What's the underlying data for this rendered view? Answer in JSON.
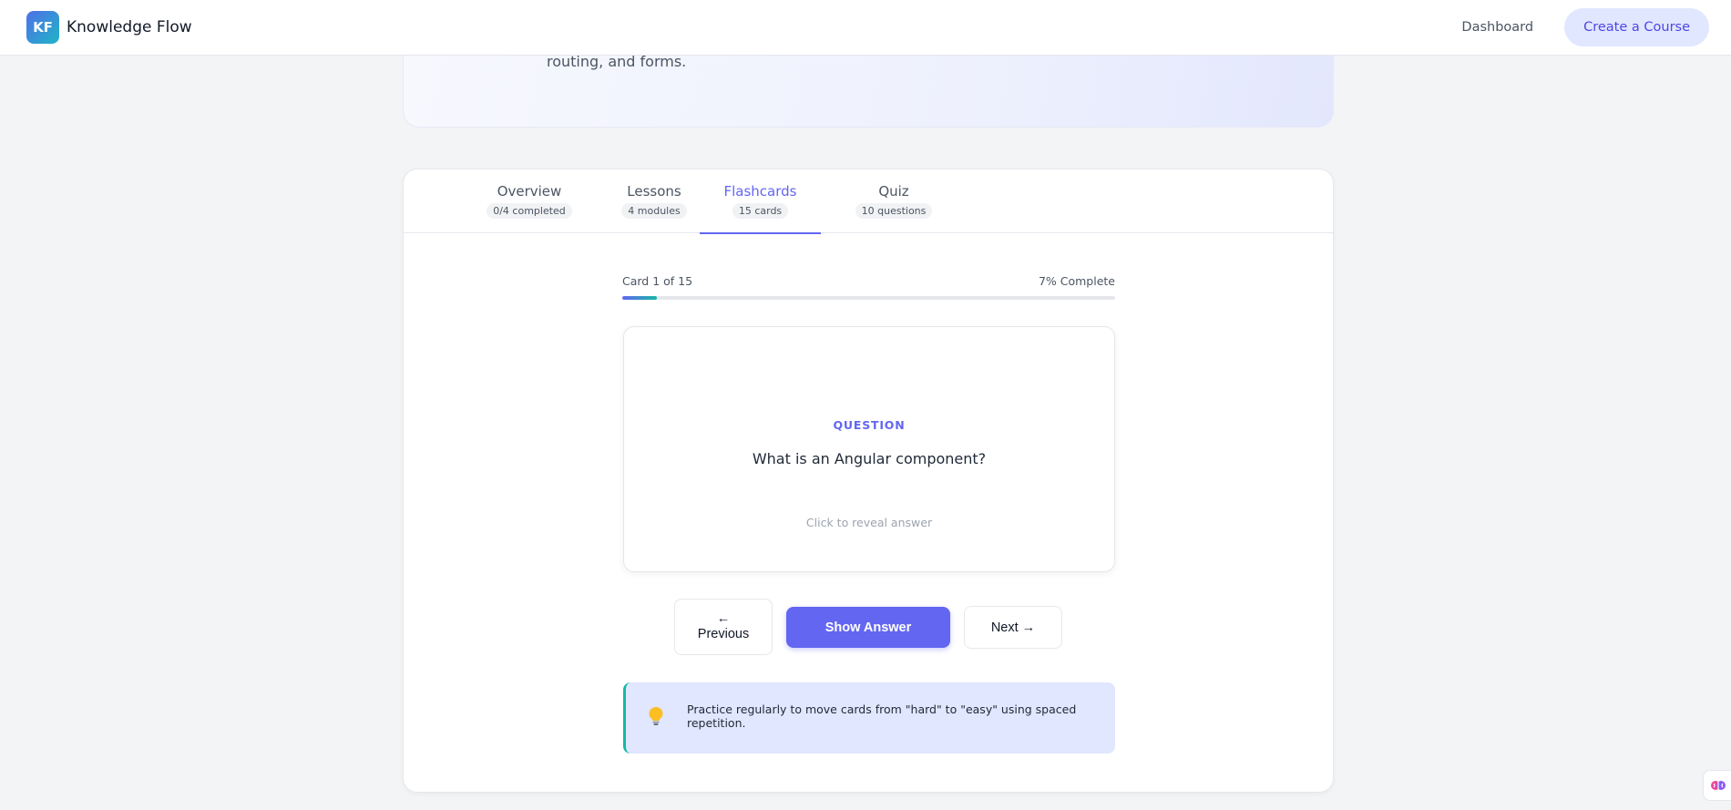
{
  "header": {
    "logo_text": "KF",
    "app_name": "Knowledge Flow",
    "nav_dashboard": "Dashboard",
    "nav_create": "Create a Course"
  },
  "hero": {
    "description_tail": "routing, and forms."
  },
  "tabs": [
    {
      "label": "Overview",
      "badge": "0/4 completed",
      "active": false
    },
    {
      "label": "Lessons",
      "badge": "4 modules",
      "active": false
    },
    {
      "label": "Flashcards",
      "badge": "15 cards",
      "active": true
    },
    {
      "label": "Quiz",
      "badge": "10 questions",
      "active": false
    }
  ],
  "progress": {
    "card_position": "Card 1 of 15",
    "percent_label": "7% Complete",
    "fraction": 0.07
  },
  "card": {
    "kind": "QUESTION",
    "question": "What is an Angular component?",
    "hint": "Click to reveal answer"
  },
  "controls": {
    "prev_arrow": "←",
    "prev_label": "Previous",
    "show_answer": "Show Answer",
    "next_label": "Next →"
  },
  "tip": {
    "icon": "lightbulb-icon",
    "text": "Practice regularly to move cards from \"hard\" to \"easy\" using spaced repetition."
  },
  "colors": {
    "accent": "#6366f1",
    "teal": "#14b8a6",
    "tip_bg": "#e0e7ff"
  }
}
